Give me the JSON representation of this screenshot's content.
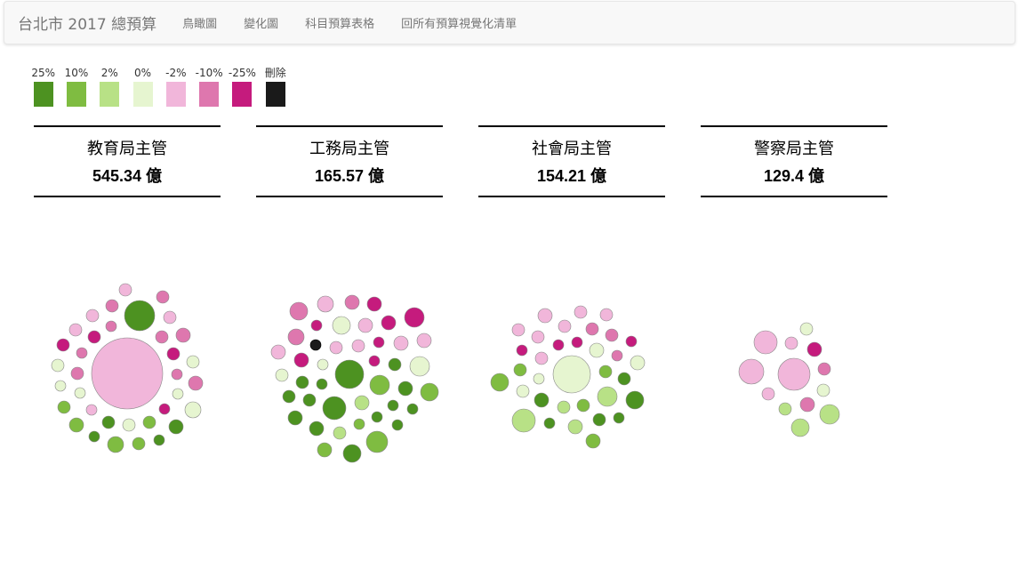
{
  "navbar": {
    "brand": "台北市 2017 總預算",
    "links": [
      "鳥瞰圖",
      "變化圖",
      "科目預算表格",
      "回所有預算視覺化清單"
    ]
  },
  "legend": [
    {
      "label": "25%",
      "color": "#4d9221"
    },
    {
      "label": "10%",
      "color": "#7fbc41"
    },
    {
      "label": "2%",
      "color": "#b8e186"
    },
    {
      "label": "0%",
      "color": "#e6f5d0"
    },
    {
      "label": "-2%",
      "color": "#f1b6da"
    },
    {
      "label": "-10%",
      "color": "#de77ae"
    },
    {
      "label": "-25%",
      "color": "#c51b7d"
    },
    {
      "label": "刪除",
      "color": "#1a1a1a"
    }
  ],
  "departments": [
    {
      "name": "教育局主管",
      "amount": "545.34 億"
    },
    {
      "name": "工務局主管",
      "amount": "165.57 億"
    },
    {
      "name": "社會局主管",
      "amount": "154.21 億"
    },
    {
      "name": "警察局主管",
      "amount": "129.4 億"
    }
  ]
}
